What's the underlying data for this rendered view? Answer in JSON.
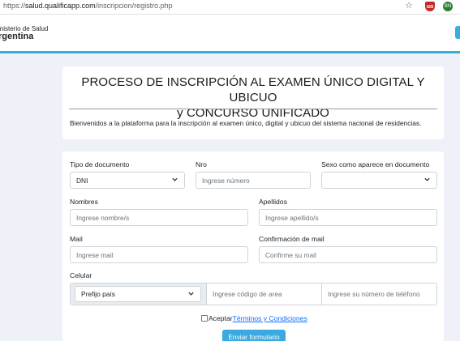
{
  "browser": {
    "url_scheme": "https://",
    "url_host": "salud.qualificapp.com",
    "url_path": "/inscripcion/registro.php",
    "extensions": [
      {
        "name": "star-icon",
        "glyph": "☆"
      },
      {
        "name": "ublock-icon",
        "glyph": "uo"
      },
      {
        "name": "bl-icon",
        "glyph": "BN"
      }
    ]
  },
  "header": {
    "brand_line1": "inisterio de Salud",
    "brand_line2": "rgentina",
    "accent_color": "#37aede"
  },
  "intro_card": {
    "title_line1": "PROCESO DE INSCRIPCIÓN AL EXAMEN ÚNICO DIGITAL Y UBICUO",
    "title_line2": "y CONCURSO UNIFICADO",
    "description": "Bienvenidos a la plataforma para la inscripción al examen único, digital y ubicuo del sistema nacional de residencias."
  },
  "form": {
    "tipo_documento": {
      "label": "Tipo de documento",
      "value": "DNI"
    },
    "nro": {
      "label": "Nro",
      "placeholder": "Ingrese número"
    },
    "sexo": {
      "label": "Sexo como aparece en documento",
      "value": ""
    },
    "nombres": {
      "label": "Nombres",
      "placeholder": "Ingrese nombre/s"
    },
    "apellidos": {
      "label": "Apellidos",
      "placeholder": "Ingrese apellido/s"
    },
    "mail": {
      "label": "Mail",
      "placeholder": "Ingrese mail"
    },
    "confirm_mail": {
      "label": "Confirmación de mail",
      "placeholder": "Confirme su mail"
    },
    "celular": {
      "label": "Celular",
      "prefix_value": "Prefijo país",
      "area_placeholder": "Ingrese código de area",
      "number_placeholder": "Ingrese su número de teléfono"
    },
    "terms": {
      "accept_text": "Aceptar",
      "link_text": " Términos y Condiciones"
    },
    "submit_label": "Enviar formulario"
  }
}
